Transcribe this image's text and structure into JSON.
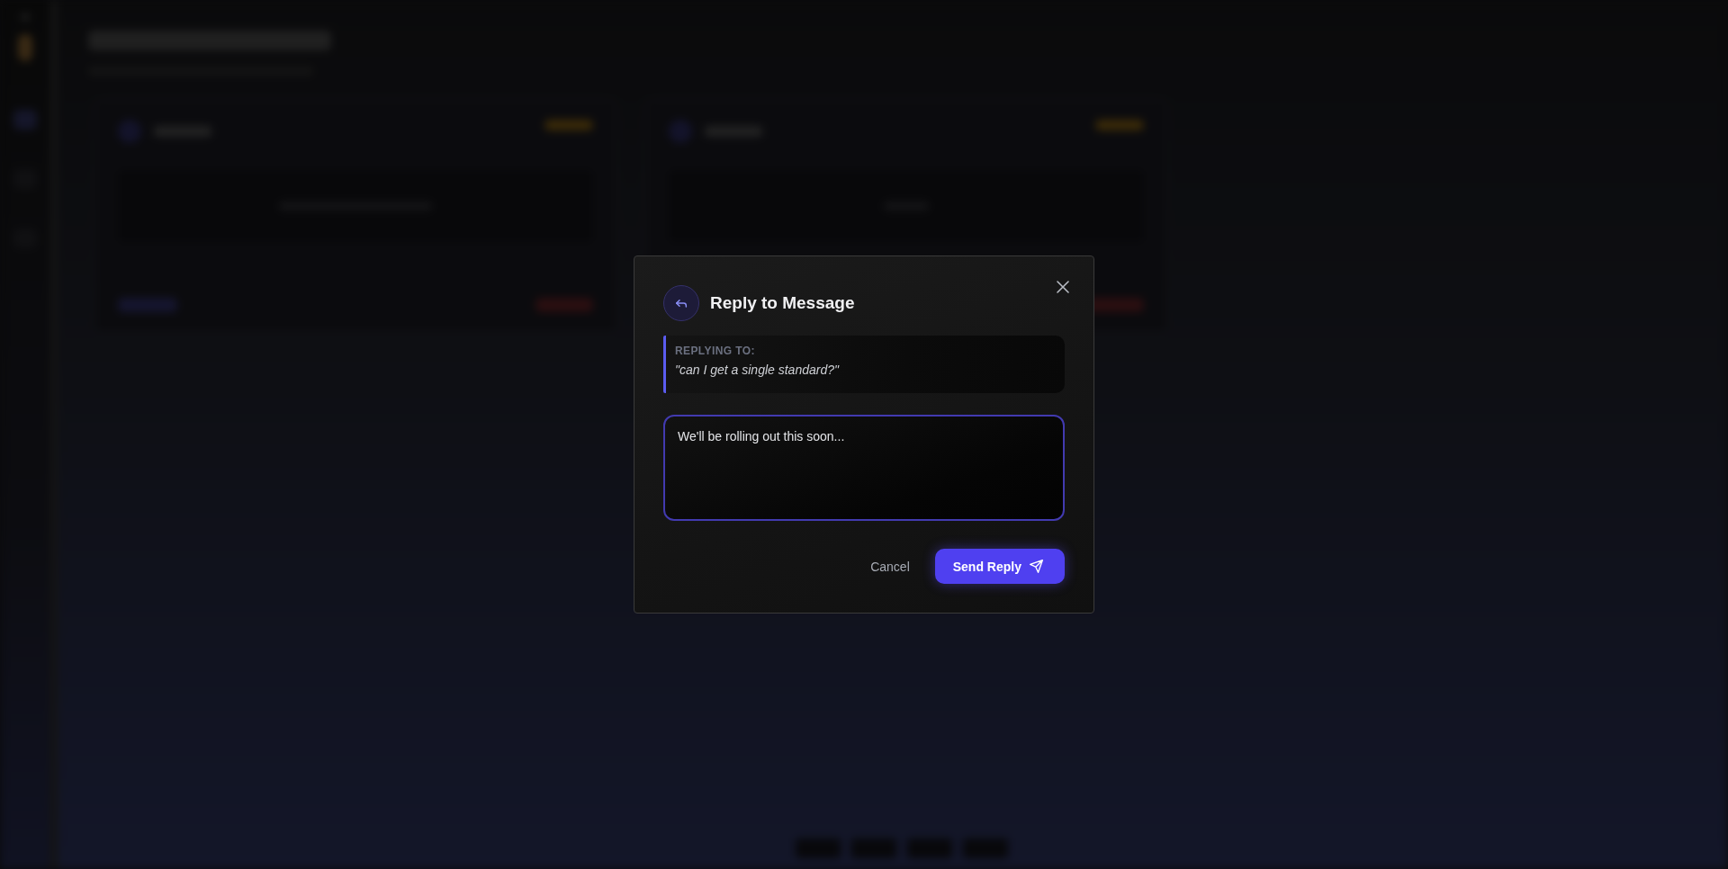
{
  "dialog": {
    "title": "Reply to Message",
    "quote": {
      "label": "REPLYING TO:",
      "text": "\"can I get a single standard?\""
    },
    "reply": {
      "value": "We'll be rolling out this soon...",
      "focused": true
    },
    "buttons": [
      {
        "label": "Cancel",
        "kind": "secondary"
      },
      {
        "label": "Send Reply",
        "kind": "primary"
      }
    ]
  }
}
